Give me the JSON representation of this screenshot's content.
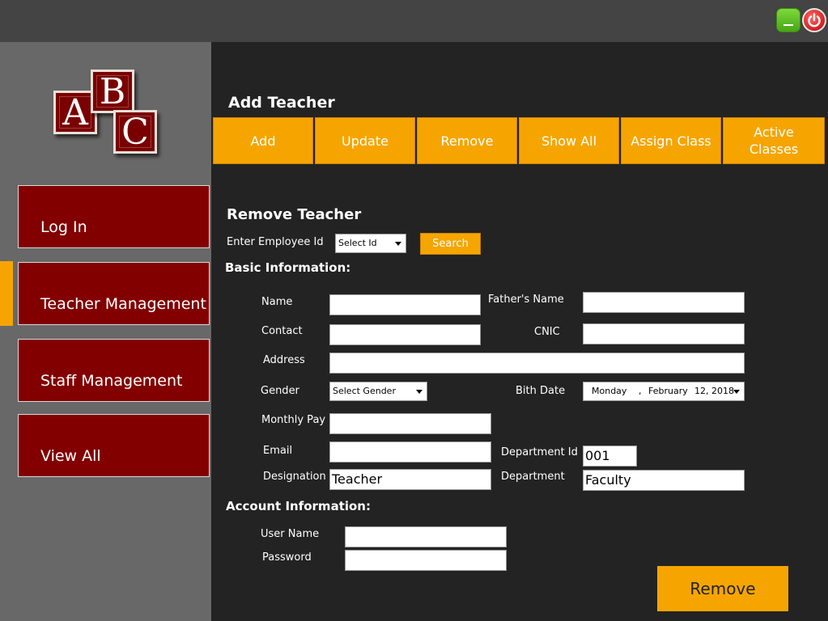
{
  "window": {
    "minimize_label": "_"
  },
  "logo": {
    "letters": [
      "A",
      "B",
      "C"
    ]
  },
  "sidebar": {
    "items": [
      {
        "label": "Log In"
      },
      {
        "label": "Teacher Management"
      },
      {
        "label": "Staff Management"
      },
      {
        "label": "View All"
      }
    ]
  },
  "header": {
    "title": "Add Teacher",
    "tabs": [
      {
        "label": "Add"
      },
      {
        "label": "Update"
      },
      {
        "label": "Remove"
      },
      {
        "label": "Show All"
      },
      {
        "label": "Assign Class"
      },
      {
        "label": "Active Classes"
      }
    ]
  },
  "form": {
    "title": "Remove Teacher",
    "employee_id_label": "Enter Employee Id",
    "employee_id_select": "Select Id",
    "search_label": "Search",
    "basic_info_title": "Basic Information:",
    "labels": {
      "name": "Name",
      "fathers_name": "Father's Name",
      "contact": "Contact",
      "cnic": "CNIC",
      "address": "Address",
      "gender": "Gender",
      "birth_date": "Bith Date",
      "monthly_pay": "Monthly Pay",
      "email": "Email",
      "department_id": "Department Id",
      "designation": "Designation",
      "department": "Department"
    },
    "values": {
      "name": "",
      "fathers_name": "",
      "contact": "",
      "cnic": "",
      "address": "",
      "gender": "Select Gender",
      "birth_date_day": "Monday",
      "birth_date_sep": ",",
      "birth_date_month": "February",
      "birth_date_rest": "12, 2018",
      "monthly_pay": "",
      "email": "",
      "department_id": "001",
      "designation": "Teacher",
      "department": "Faculty"
    },
    "account_info_title": "Account Information:",
    "account_labels": {
      "user_name": "User Name",
      "password": "Password"
    },
    "account_values": {
      "user_name": "",
      "password": ""
    },
    "submit_label": "Remove"
  },
  "colors": {
    "accent": "#f6a500",
    "sidebar_item": "#820000",
    "sidebar_bg": "#686868",
    "content_bg": "#232323",
    "topbar": "#444444"
  }
}
